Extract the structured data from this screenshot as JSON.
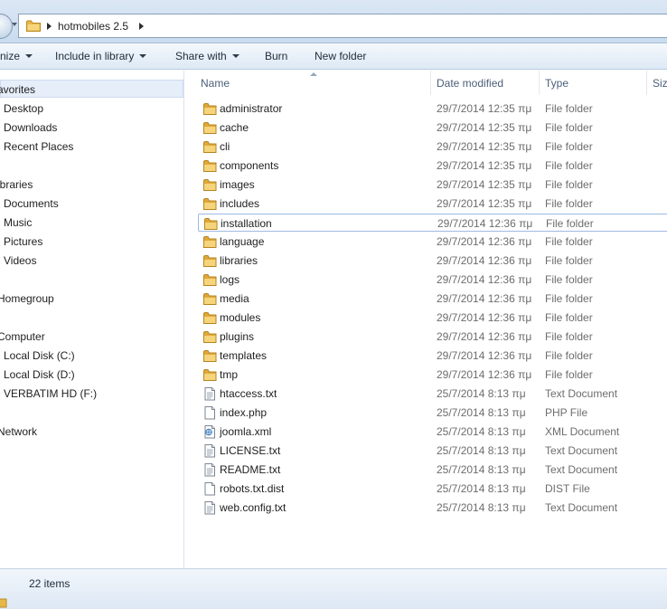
{
  "address": {
    "path": "hotmobiles 2.5"
  },
  "toolbar": {
    "organize": "nize",
    "include_library": "Include in library",
    "share_with": "Share with",
    "burn": "Burn",
    "new_folder": "New folder"
  },
  "nav": {
    "favorites": "avorites",
    "desktop": "Desktop",
    "downloads": "Downloads",
    "recent": "Recent Places",
    "libraries": "ibraries",
    "documents": "Documents",
    "music": "Music",
    "pictures": "Pictures",
    "videos": "Videos",
    "homegroup": "Homegroup",
    "computer": "Computer",
    "disk_c": "Local Disk (C:)",
    "disk_d": "Local Disk (D:)",
    "verbatim": "VERBATIM HD (F:)",
    "network": "Network"
  },
  "columns": {
    "name": "Name",
    "date": "Date modified",
    "type": "Type",
    "size": "Siz"
  },
  "files": [
    {
      "name": "administrator",
      "date": "29/7/2014 12:35 πμ",
      "type": "File folder",
      "icon": "folder-icon"
    },
    {
      "name": "cache",
      "date": "29/7/2014 12:35 πμ",
      "type": "File folder",
      "icon": "folder-icon"
    },
    {
      "name": "cli",
      "date": "29/7/2014 12:35 πμ",
      "type": "File folder",
      "icon": "folder-icon"
    },
    {
      "name": "components",
      "date": "29/7/2014 12:35 πμ",
      "type": "File folder",
      "icon": "folder-icon"
    },
    {
      "name": "images",
      "date": "29/7/2014 12:35 πμ",
      "type": "File folder",
      "icon": "folder-icon"
    },
    {
      "name": "includes",
      "date": "29/7/2014 12:35 πμ",
      "type": "File folder",
      "icon": "folder-icon"
    },
    {
      "name": "installation",
      "date": "29/7/2014 12:36 πμ",
      "type": "File folder",
      "icon": "folder-icon"
    },
    {
      "name": "language",
      "date": "29/7/2014 12:36 πμ",
      "type": "File folder",
      "icon": "folder-icon"
    },
    {
      "name": "libraries",
      "date": "29/7/2014 12:36 πμ",
      "type": "File folder",
      "icon": "folder-icon"
    },
    {
      "name": "logs",
      "date": "29/7/2014 12:36 πμ",
      "type": "File folder",
      "icon": "folder-icon"
    },
    {
      "name": "media",
      "date": "29/7/2014 12:36 πμ",
      "type": "File folder",
      "icon": "folder-icon"
    },
    {
      "name": "modules",
      "date": "29/7/2014 12:36 πμ",
      "type": "File folder",
      "icon": "folder-icon"
    },
    {
      "name": "plugins",
      "date": "29/7/2014 12:36 πμ",
      "type": "File folder",
      "icon": "folder-icon"
    },
    {
      "name": "templates",
      "date": "29/7/2014 12:36 πμ",
      "type": "File folder",
      "icon": "folder-icon"
    },
    {
      "name": "tmp",
      "date": "29/7/2014 12:36 πμ",
      "type": "File folder",
      "icon": "folder-icon"
    },
    {
      "name": "htaccess.txt",
      "date": "25/7/2014 8:13 πμ",
      "type": "Text Document",
      "icon": "text-file-icon"
    },
    {
      "name": "index.php",
      "date": "25/7/2014 8:13 πμ",
      "type": "PHP File",
      "icon": "file-icon"
    },
    {
      "name": "joomla.xml",
      "date": "25/7/2014 8:13 πμ",
      "type": "XML Document",
      "icon": "xml-file-icon"
    },
    {
      "name": "LICENSE.txt",
      "date": "25/7/2014 8:13 πμ",
      "type": "Text Document",
      "icon": "text-file-icon"
    },
    {
      "name": "README.txt",
      "date": "25/7/2014 8:13 πμ",
      "type": "Text Document",
      "icon": "text-file-icon"
    },
    {
      "name": "robots.txt.dist",
      "date": "25/7/2014 8:13 πμ",
      "type": "DIST File",
      "icon": "file-icon"
    },
    {
      "name": "web.config.txt",
      "date": "25/7/2014 8:13 πμ",
      "type": "Text Document",
      "icon": "text-file-icon"
    }
  ],
  "status": {
    "items": "22 items"
  }
}
